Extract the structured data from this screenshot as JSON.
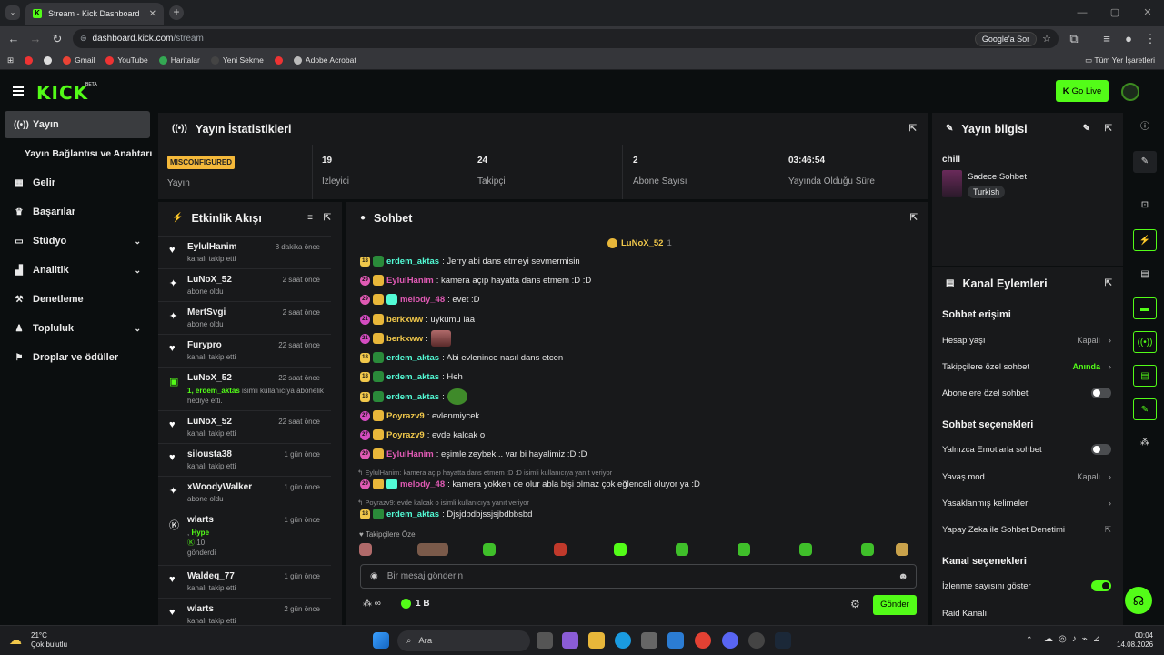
{
  "browser": {
    "tab_title": "Stream - Kick Dashboard",
    "url_host": "dashboard.kick.com",
    "url_path": "/stream",
    "google_sor": "Google'a Sor",
    "bookmarks": [
      "Gmail",
      "YouTube",
      "Haritalar",
      "Yeni Sekme",
      "Adobe Acrobat"
    ],
    "all_bookmarks": "Tüm Yer İşaretleri"
  },
  "header": {
    "logo": "KICK",
    "beta": "BETA",
    "go_live": "Go Live"
  },
  "sidebar": {
    "items": [
      {
        "label": "Yayın",
        "icon": "broadcast-icon"
      },
      {
        "label": "Yayın Bağlantısı ve Anahtarı",
        "icon": ""
      },
      {
        "label": "Gelir",
        "icon": "revenue-icon"
      },
      {
        "label": "Başarılar",
        "icon": "trophy-icon"
      },
      {
        "label": "Stüdyo",
        "icon": "studio-icon"
      },
      {
        "label": "Analitik",
        "icon": "analytics-icon"
      },
      {
        "label": "Denetleme",
        "icon": "moderation-icon"
      },
      {
        "label": "Topluluk",
        "icon": "community-icon"
      },
      {
        "label": "Droplar ve ödüller",
        "icon": "drops-icon"
      }
    ]
  },
  "stats": {
    "title": "Yayın İstatistikleri",
    "status_badge": "MISCONFIGURED",
    "status_label": "Yayın",
    "viewers": "19",
    "viewers_label": "İzleyici",
    "followers": "24",
    "followers_label": "Takipçi",
    "subs": "2",
    "subs_label": "Abone Sayısı",
    "uptime": "03:46:54",
    "uptime_label": "Yayında Olduğu Süre"
  },
  "activity": {
    "title": "Etkinlik Akışı",
    "items": [
      {
        "name": "EylulHanim",
        "time": "8 dakika önce",
        "sub": "kanalı takip etti",
        "icon": "heart-icon"
      },
      {
        "name": "LuNoX_52",
        "time": "2 saat önce",
        "sub": "abone oldu",
        "icon": "sparkle-icon"
      },
      {
        "name": "MertSvgi",
        "time": "2 saat önce",
        "sub": "abone oldu",
        "icon": "sparkle-icon"
      },
      {
        "name": "Furypro",
        "time": "22 saat önce",
        "sub": "kanalı takip etti",
        "icon": "heart-icon"
      },
      {
        "name": "LuNoX_52",
        "time": "22 saat önce",
        "sub_hl": "1, erdem_aktas",
        "sub": " isimli kullanıcıya abonelik hediye etti.",
        "icon": "gift-icon"
      },
      {
        "name": "LuNoX_52",
        "time": "22 saat önce",
        "sub": "kanalı takip etti",
        "icon": "heart-icon"
      },
      {
        "name": "silousta38",
        "time": "1 gün önce",
        "sub": "kanalı takip etti",
        "icon": "heart-icon"
      },
      {
        "name": "xWoodyWalker",
        "time": "1 gün önce",
        "sub": "abone oldu",
        "icon": "sparkle-icon"
      },
      {
        "name": "wlarts",
        "time": "1 gün önce",
        "hype_pre": ", ",
        "hype": "Hype",
        "amount": "10",
        "sub": "gönderdi",
        "icon": "kick-icon"
      },
      {
        "name": "Waldeq_77",
        "time": "1 gün önce",
        "sub": "kanalı takip etti",
        "icon": "heart-icon"
      },
      {
        "name": "wlarts",
        "time": "2 gün önce",
        "sub": "kanalı takip etti",
        "icon": "heart-icon"
      }
    ]
  },
  "chat": {
    "title": "Sohbet",
    "pinned_user": "LuNoX_52",
    "pinned_count": "1",
    "messages": [
      {
        "badge": "18",
        "user": "erdem_aktas",
        "text": ": Jerry abi dans etmeyi sevmermisin"
      },
      {
        "badge": "29",
        "user": "EylulHanim",
        "text": ": kamera açıp hayatta dans etmem :D :D"
      },
      {
        "badge": "29",
        "user": "melody_48",
        "text": ": evet :D"
      },
      {
        "badge": "21",
        "user": "berkxww",
        "text": ": uykumu laa"
      },
      {
        "badge": "21",
        "user": "berkxww",
        "text": ":"
      },
      {
        "badge": "18",
        "user": "erdem_aktas",
        "text": ": Abi evlenince nasıl dans etcen"
      },
      {
        "badge": "18",
        "user": "erdem_aktas",
        "text": ": Heh"
      },
      {
        "badge": "18",
        "user": "erdem_aktas",
        "text": ":"
      },
      {
        "badge": "27",
        "user": "Poyrazv9",
        "text": ": evlenmiycek"
      },
      {
        "badge": "27",
        "user": "Poyrazv9",
        "text": ": evde kalcak o"
      },
      {
        "badge": "29",
        "user": "EylulHanim",
        "text": ": eşimle zeybek... var bi hayalimiz :D :D"
      },
      {
        "badge": "29",
        "user": "melody_48",
        "text": ": kamera yokken de olur abla bişi olmaz çok eğlenceli oluyor ya :D"
      },
      {
        "badge": "18",
        "user": "erdem_aktas",
        "text": ": Djsjdbdbjssjsjbdbbsbd"
      }
    ],
    "reply1": "EylulHanim: kamera açıp hayatta dans etmem :D :D isimli kullanıcıya yanıt veriyor",
    "reply2": "Poyrazv9: evde kalcak o isimli kullanıcıya yanıt veriyor",
    "emote_section": "Takipçilere Özel",
    "placeholder": "Bir mesaj gönderin",
    "points": "1 B",
    "send": "Gönder"
  },
  "stream_info": {
    "title": "Yayın bilgisi",
    "stream_title": "chill",
    "category": "Sadece Sohbet",
    "tag": "Turkish"
  },
  "channel_actions": {
    "title": "Kanal Eylemleri",
    "chat_access": "Sohbet erişimi",
    "account_age": "Hesap yaşı",
    "account_age_val": "Kapalı",
    "followers_only": "Takipçilere özel sohbet",
    "followers_only_val": "Anında",
    "subs_only": "Abonelere özel sohbet",
    "chat_options": "Sohbet seçenekleri",
    "emote_only": "Yalnızca Emotlarla sohbet",
    "slow_mode": "Yavaş mod",
    "slow_mode_val": "Kapalı",
    "banned_words": "Yasaklanmış kelimeler",
    "ai_moderation": "Yapay Zeka ile Sohbet Denetimi",
    "channel_options": "Kanal seçenekleri",
    "show_viewcount": "İzlenme sayısını göster",
    "raid": "Raid Kanalı"
  },
  "taskbar": {
    "temp": "21°C",
    "weather": "Çok bulutlu",
    "search": "Ara",
    "time": "00:04",
    "date": "14.08.2026"
  },
  "colors": {
    "accent": "#53fc18",
    "panel": "#18191b",
    "bg": "#0b0e0f"
  }
}
